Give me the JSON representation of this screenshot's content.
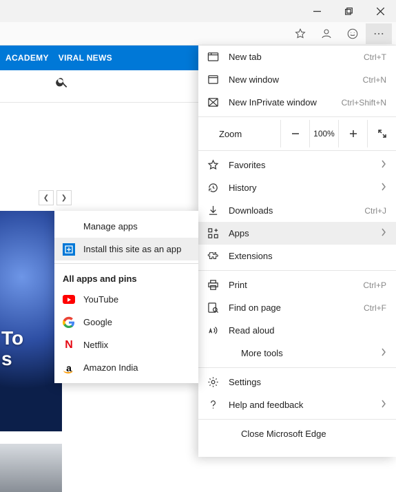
{
  "page": {
    "nav_items": [
      "ACADEMY",
      "VIRAL NEWS"
    ],
    "hero_frag_1": "To",
    "hero_frag_2": "s"
  },
  "menu": {
    "new_tab": {
      "label": "New tab",
      "shortcut": "Ctrl+T"
    },
    "new_window": {
      "label": "New window",
      "shortcut": "Ctrl+N"
    },
    "new_inprivate": {
      "label": "New InPrivate window",
      "shortcut": "Ctrl+Shift+N"
    },
    "zoom": {
      "label": "Zoom",
      "value": "100%"
    },
    "favorites": {
      "label": "Favorites"
    },
    "history": {
      "label": "History"
    },
    "downloads": {
      "label": "Downloads",
      "shortcut": "Ctrl+J"
    },
    "apps": {
      "label": "Apps"
    },
    "extensions": {
      "label": "Extensions"
    },
    "print": {
      "label": "Print",
      "shortcut": "Ctrl+P"
    },
    "find": {
      "label": "Find on page",
      "shortcut": "Ctrl+F"
    },
    "read_aloud": {
      "label": "Read aloud"
    },
    "more_tools": {
      "label": "More tools"
    },
    "settings": {
      "label": "Settings"
    },
    "help": {
      "label": "Help and feedback"
    },
    "close": {
      "label": "Close Microsoft Edge"
    }
  },
  "apps_submenu": {
    "manage": "Manage apps",
    "install": "Install this site as an app",
    "heading": "All apps and pins",
    "items": [
      {
        "name": "YouTube"
      },
      {
        "name": "Google"
      },
      {
        "name": "Netflix"
      },
      {
        "name": "Amazon India"
      }
    ]
  }
}
